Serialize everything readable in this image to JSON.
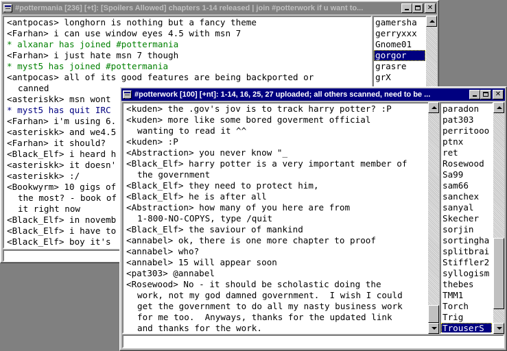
{
  "back_window": {
    "title": "#pottermania [236] [+t]: [Spoilers Allowed] chapters 1-14 released | join #potterwork if u want to...",
    "lines": [
      {
        "text": "<antpocas> longhorn is nothing but a fancy theme",
        "style": "normal"
      },
      {
        "text": "<Farhan> i can use window eyes 4.5 with msn 7",
        "style": "normal"
      },
      {
        "text": "* alxanar has joined #pottermania",
        "style": "green"
      },
      {
        "text": "<Farhan> i just hate msn 7 though",
        "style": "normal"
      },
      {
        "text": "* myst5 has joined #pottermania",
        "style": "green"
      },
      {
        "text": "<antpocas> all of its good features are being backported or",
        "style": "normal"
      },
      {
        "text": "canned",
        "style": "wrap"
      },
      {
        "text": "<asteriskk> msn wont",
        "style": "normal"
      },
      {
        "text": "* myst5 has quit IRC",
        "style": "navy"
      },
      {
        "text": "<Farhan> i'm using 6.",
        "style": "normal"
      },
      {
        "text": "<asteriskk> and we4.5",
        "style": "normal"
      },
      {
        "text": "<Farhan> it should?",
        "style": "normal"
      },
      {
        "text": "<Black_Elf> i heard h",
        "style": "normal"
      },
      {
        "text": "<asteriskk> it doesn'",
        "style": "normal"
      },
      {
        "text": "<asteriskk> :/",
        "style": "normal"
      },
      {
        "text": "<Bookwyrm> 10 gigs of",
        "style": "normal"
      },
      {
        "text": "the most? - book of",
        "style": "wrap"
      },
      {
        "text": "it right now",
        "style": "wrap"
      },
      {
        "text": "<Black_Elf> in novemb",
        "style": "normal"
      },
      {
        "text": "<Black_Elf> i have to",
        "style": "normal"
      },
      {
        "text": "<Black_Elf> boy it's",
        "style": "normal"
      }
    ],
    "nicks": [
      "gamersha",
      "gerryxxx",
      "Gnome01",
      "gorgor",
      "grasre",
      "grX"
    ],
    "selected_nick": "gorgor"
  },
  "front_window": {
    "title": "#potterwork [100] [+nt]: 1-14, 16, 25, 27 uploaded; all others scanned, need to be ...",
    "lines": [
      {
        "text": "<kuden> the .gov's jov is to track harry potter? :P",
        "style": "normal"
      },
      {
        "text": "<kuden> more like some bored goverment official",
        "style": "normal"
      },
      {
        "text": "wanting to read it ^^",
        "style": "wrap"
      },
      {
        "text": "<kuden> :P",
        "style": "normal"
      },
      {
        "text": "<Abstraction> you never know \"_",
        "style": "normal"
      },
      {
        "text": "<Black_Elf> harry potter is a very important member of",
        "style": "normal"
      },
      {
        "text": "the government",
        "style": "wrap"
      },
      {
        "text": "<Black_Elf> they need to protect him,",
        "style": "normal"
      },
      {
        "text": "<Black_Elf> he is after all",
        "style": "normal"
      },
      {
        "text": "<Abstraction> how many of you here are from",
        "style": "normal"
      },
      {
        "text": "1-800-NO-COPYS, type /quit",
        "style": "wrap"
      },
      {
        "text": "<Black_Elf> the saviour of mankind",
        "style": "normal"
      },
      {
        "text": "<annabel> ok, there is one more chapter to proof",
        "style": "normal"
      },
      {
        "text": "<annabel> who?",
        "style": "normal"
      },
      {
        "text": "<annabel> 15 will appear soon",
        "style": "normal"
      },
      {
        "text": "<pat303> @annabel",
        "style": "normal"
      },
      {
        "text": "<Rosewood> No - it should be scholastic doing the",
        "style": "normal"
      },
      {
        "text": "work, not my god damned government.  I wish I could",
        "style": "wrap"
      },
      {
        "text": "get the government to do all my nasty business work",
        "style": "wrap"
      },
      {
        "text": "for me too.  Anyways, thanks for the updated link",
        "style": "wrap"
      },
      {
        "text": "and thanks for the work.",
        "style": "wrap"
      }
    ],
    "nicks": [
      "paradon",
      "pat303",
      "perritooo",
      "ptnx",
      "ret",
      "Rosewood",
      "Sa99",
      "sam66",
      "sanchex",
      "sanyal",
      "Skecher",
      "sorjin",
      "sortingha",
      "splitbrai",
      "Stiffler2",
      "syllogism",
      "thebes",
      "TMM1",
      "Torch",
      "Trig",
      "TrouserS"
    ],
    "selected_nick": "TrouserS",
    "scroll_position": 0.9,
    "input_value": ""
  }
}
